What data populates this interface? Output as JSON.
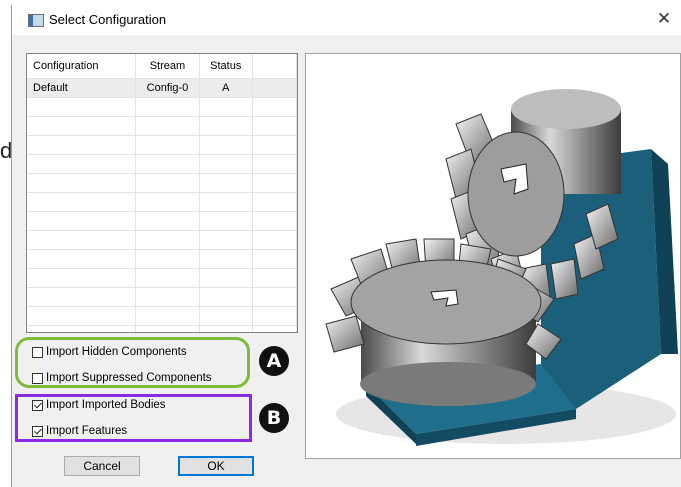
{
  "window": {
    "title": "Select Configuration",
    "close_glyph": "✕"
  },
  "background_letter": "d",
  "config_table": {
    "headers": [
      "Configuration",
      "Stream",
      "Status"
    ],
    "rows": [
      {
        "configuration": "Default",
        "stream": "Config-0",
        "status": "A"
      }
    ]
  },
  "options": [
    {
      "label": "Import Hidden Components",
      "checked": false
    },
    {
      "label": "Import Suppressed Components",
      "checked": false
    },
    {
      "label": "Import Imported Bodies",
      "checked": true
    },
    {
      "label": "Import Features",
      "checked": true
    }
  ],
  "callouts": {
    "a": "A",
    "b": "B",
    "a_color": "#7dbb3c",
    "b_color": "#8a2be2"
  },
  "buttons": {
    "cancel": "Cancel",
    "ok": "OK"
  },
  "preview": {
    "icon": "bevel-gears-model-image"
  }
}
